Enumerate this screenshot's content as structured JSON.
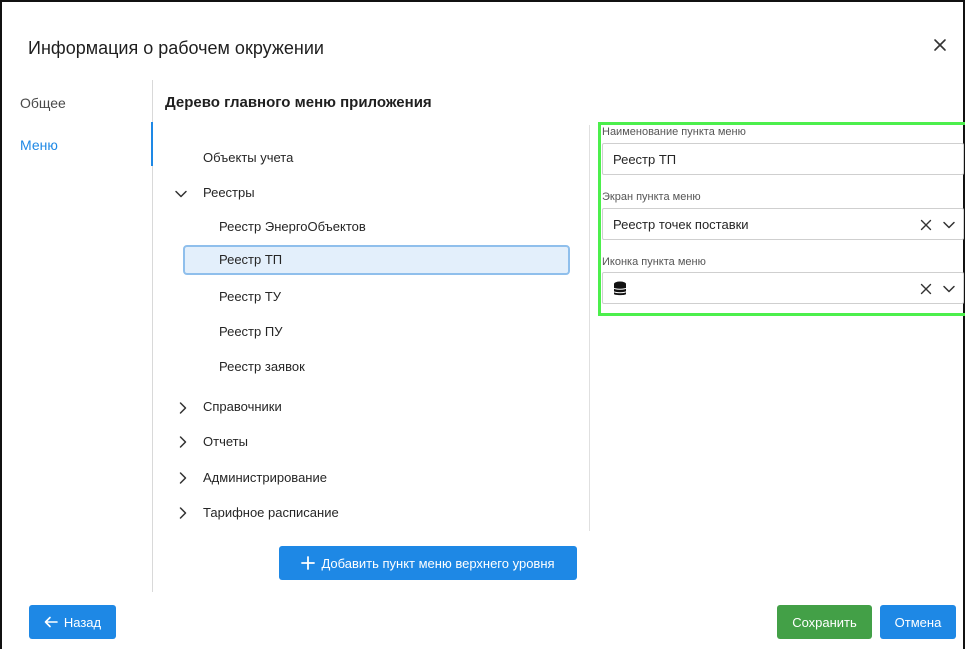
{
  "dialog": {
    "title": "Информация о рабочем окружении"
  },
  "nav": {
    "items": [
      {
        "label": "Общее"
      },
      {
        "label": "Меню"
      }
    ]
  },
  "tree": {
    "title": "Дерево главного меню приложения",
    "items": [
      {
        "label": "Объекты учета"
      },
      {
        "label": "Реестры"
      },
      {
        "label": "Реестр ЭнергоОбъектов"
      },
      {
        "label": "Реестр ТП"
      },
      {
        "label": "Реестр ТУ"
      },
      {
        "label": "Реестр ПУ"
      },
      {
        "label": "Реестр заявок"
      },
      {
        "label": "Справочники"
      },
      {
        "label": "Отчеты"
      },
      {
        "label": "Администрирование"
      },
      {
        "label": "Тарифное расписание"
      }
    ],
    "add_button": "Добавить пункт меню верхнего уровня"
  },
  "form": {
    "name_label": "Наименование пункта меню",
    "name_value": "Реестр ТП",
    "screen_label": "Экран пункта меню",
    "screen_value": "Реестр точек поставки",
    "icon_label": "Иконка пункта меню",
    "icon_value": "database-icon"
  },
  "footer": {
    "back": "Назад",
    "save": "Сохранить",
    "cancel": "Отмена"
  },
  "colors": {
    "primary": "#1e88e5",
    "success": "#43a047",
    "highlight": "#4cef4c",
    "selected_bg": "#e3effb"
  }
}
